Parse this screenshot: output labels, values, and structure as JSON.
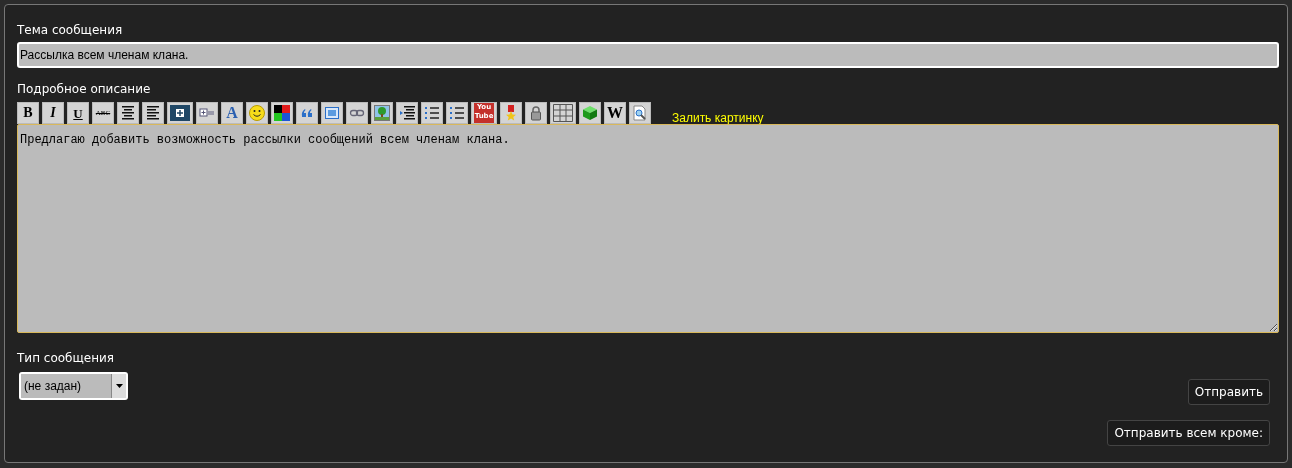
{
  "subject": {
    "label": "Тема сообщения",
    "value": "Рассылка всем членам клана."
  },
  "description": {
    "label": "Подробное описание",
    "toolbar": [
      {
        "kind": "bold",
        "label": "B"
      },
      {
        "kind": "italic",
        "label": "I"
      },
      {
        "kind": "underline",
        "label": "U"
      },
      {
        "kind": "strike",
        "label": "ABC"
      },
      {
        "kind": "align-center"
      },
      {
        "kind": "align-left"
      },
      {
        "kind": "box-plus"
      },
      {
        "kind": "box-plus-small"
      },
      {
        "kind": "font",
        "label": "A"
      },
      {
        "kind": "smiley"
      },
      {
        "kind": "color"
      },
      {
        "kind": "quote"
      },
      {
        "kind": "frame"
      },
      {
        "kind": "link"
      },
      {
        "kind": "image"
      },
      {
        "kind": "indent"
      },
      {
        "kind": "bullet-list"
      },
      {
        "kind": "number-list"
      },
      {
        "kind": "youtube",
        "label": "You Tube"
      },
      {
        "kind": "medal"
      },
      {
        "kind": "lock"
      },
      {
        "kind": "table"
      },
      {
        "kind": "cube"
      },
      {
        "kind": "wiki",
        "label": "W"
      },
      {
        "kind": "preview"
      }
    ],
    "upload_link": "Залить картинку",
    "value": "Предлагаю добавить возможность рассылки сообщений всем членам клана."
  },
  "type": {
    "label": "Тип сообщения",
    "value": "(не задан)"
  },
  "buttons": [
    "Отправить",
    "Отправить всем кроме:"
  ]
}
